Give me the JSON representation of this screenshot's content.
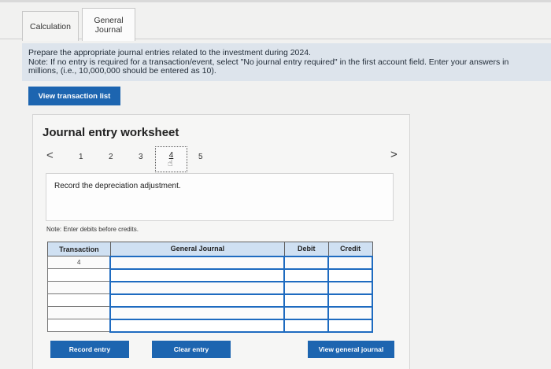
{
  "tabs": [
    {
      "label": "Calculation"
    },
    {
      "label": "General Journal",
      "line1": "General",
      "line2": "Journal"
    }
  ],
  "instructions": {
    "line1": "Prepare the appropriate journal entries related to the investment during 2024.",
    "line2": "Note: If no entry is required for a transaction/event, select \"No journal entry required\" in the first account field. Enter your answers in",
    "line3": "millions, (i.e., 10,000,000 should be entered as 10)."
  },
  "view_transaction_list_label": "View transaction list",
  "worksheet": {
    "title": "Journal entry worksheet",
    "pager": {
      "prev_symbol": "<",
      "next_symbol": ">",
      "pages": [
        "1",
        "2",
        "3",
        "4",
        "5"
      ],
      "current": "4"
    },
    "description": "Record the depreciation adjustment.",
    "note": "Note: Enter debits before credits.",
    "table": {
      "headers": [
        "Transaction",
        "General Journal",
        "Debit",
        "Credit"
      ],
      "rows": [
        [
          "4",
          "",
          "",
          ""
        ],
        [
          "",
          "",
          "",
          ""
        ],
        [
          "",
          "",
          "",
          ""
        ],
        [
          "",
          "",
          "",
          ""
        ],
        [
          "",
          "",
          "",
          ""
        ],
        [
          "",
          "",
          "",
          ""
        ]
      ]
    }
  },
  "buttons": {
    "record": "Record entry",
    "clear": "Clear entry",
    "view_general_journal": "View general journal"
  },
  "colors": {
    "button_blue": "#1d65b0",
    "header_blue": "#cfe0f2",
    "instruction_bg": "#dde4ec",
    "selected_border": "#1e6bc0"
  },
  "icons": {
    "prev": "chevron-left-icon",
    "next": "chevron-right-icon",
    "cursor": "hand-pointer-icon"
  }
}
